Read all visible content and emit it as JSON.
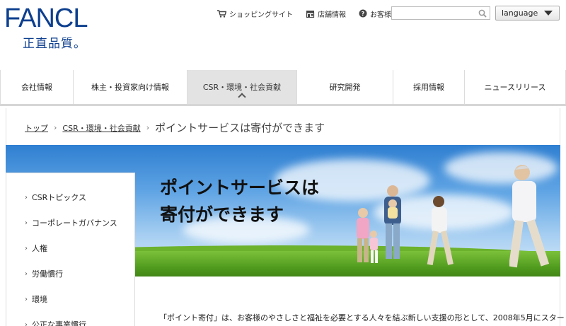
{
  "brand": {
    "logo_text": "FANCL",
    "tagline": "正直品質。",
    "color": "#0d3f8f"
  },
  "utility_links": [
    {
      "label": "ショッピングサイト",
      "icon": "cart-icon"
    },
    {
      "label": "店舗情報",
      "icon": "store-icon"
    },
    {
      "label": "お客様窓口",
      "icon": "help-icon"
    }
  ],
  "search": {
    "placeholder": "",
    "value": "",
    "icon": "search-icon"
  },
  "language": {
    "label": "language"
  },
  "global_nav": [
    {
      "label": "会社情報",
      "active": false
    },
    {
      "label": "株主・投資家向け情報",
      "active": false
    },
    {
      "label": "CSR・環境・社会貢献",
      "active": true
    },
    {
      "label": "研究開発",
      "active": false
    },
    {
      "label": "採用情報",
      "active": false
    },
    {
      "label": "ニュースリリース",
      "active": false
    }
  ],
  "breadcrumb": {
    "items": [
      "トップ",
      "CSR・環境・社会貢献"
    ],
    "current": "ポイントサービスは寄付ができます",
    "separator": "›"
  },
  "hero": {
    "title_line1": "ポイントサービスは",
    "title_line2": "寄付ができます"
  },
  "side_menu": [
    {
      "label": "CSRトピックス"
    },
    {
      "label": "コーポレートガバナンス"
    },
    {
      "label": "人権"
    },
    {
      "label": "労働慣行"
    },
    {
      "label": "環境"
    },
    {
      "label": "公正な事業慣行"
    }
  ],
  "intro_text": "「ポイント寄付」は、お客様のやさしさと福祉を必要とする人々を結ぶ新しい支援の形として、2008年5月にスター"
}
